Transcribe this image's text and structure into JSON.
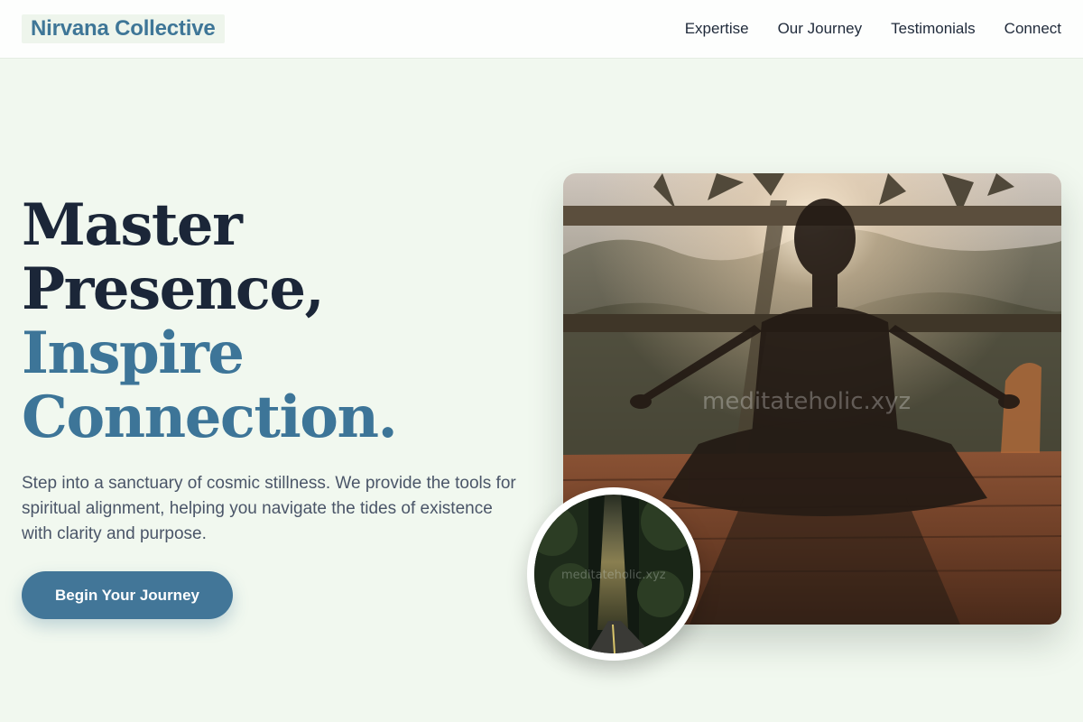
{
  "header": {
    "brand": "Nirvana Collective",
    "nav": [
      "Expertise",
      "Our Journey",
      "Testimonials",
      "Connect"
    ]
  },
  "hero": {
    "headline_line1": "Master",
    "headline_line2": "Presence,",
    "headline_line3": "Inspire",
    "headline_line4": "Connection.",
    "description": "Step into a sanctuary of cosmic stillness. We provide the tools for spiritual alignment, helping you navigate the tides of existence with clarity and purpose.",
    "cta_label": "Begin Your Journey",
    "image_watermark": "meditateholic.xyz",
    "inset_watermark": "meditateholic.xyz"
  },
  "colors": {
    "accent": "#3e7697",
    "heading": "#1b2638",
    "background": "#f1f8ef",
    "button": "#427698"
  },
  "icons": {
    "hero_image": "meditation-photo",
    "inset_image": "forest-road-photo"
  }
}
